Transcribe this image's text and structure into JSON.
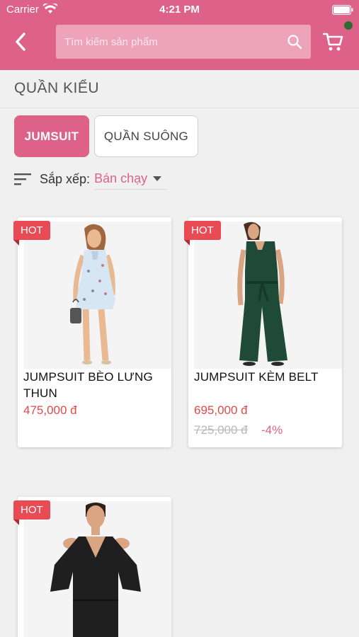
{
  "status_bar": {
    "carrier": "Carrier",
    "time": "4:21 PM"
  },
  "search": {
    "placeholder": "Tìm kiếm sản phẩm"
  },
  "category": {
    "title": "QUẦN KIỂU"
  },
  "tabs": [
    {
      "label": "JUMSUIT",
      "active": true
    },
    {
      "label": "QUẦN SUÔNG",
      "active": false
    }
  ],
  "sort": {
    "label": "Sắp xếp:",
    "value": "Bán chạy"
  },
  "products": [
    {
      "badge": "HOT",
      "name": "JUMPSUIT BÈO LƯNG THUN",
      "price": "475,000 đ"
    },
    {
      "badge": "HOT",
      "name": "JUMPSUIT KÈM BELT",
      "price": "695,000 đ",
      "old_price": "725,000 đ",
      "discount": "-4%"
    },
    {
      "badge": "HOT"
    }
  ],
  "colors": {
    "accent": "#de6189",
    "price": "#e04a4a",
    "badge": "#e94b55"
  }
}
